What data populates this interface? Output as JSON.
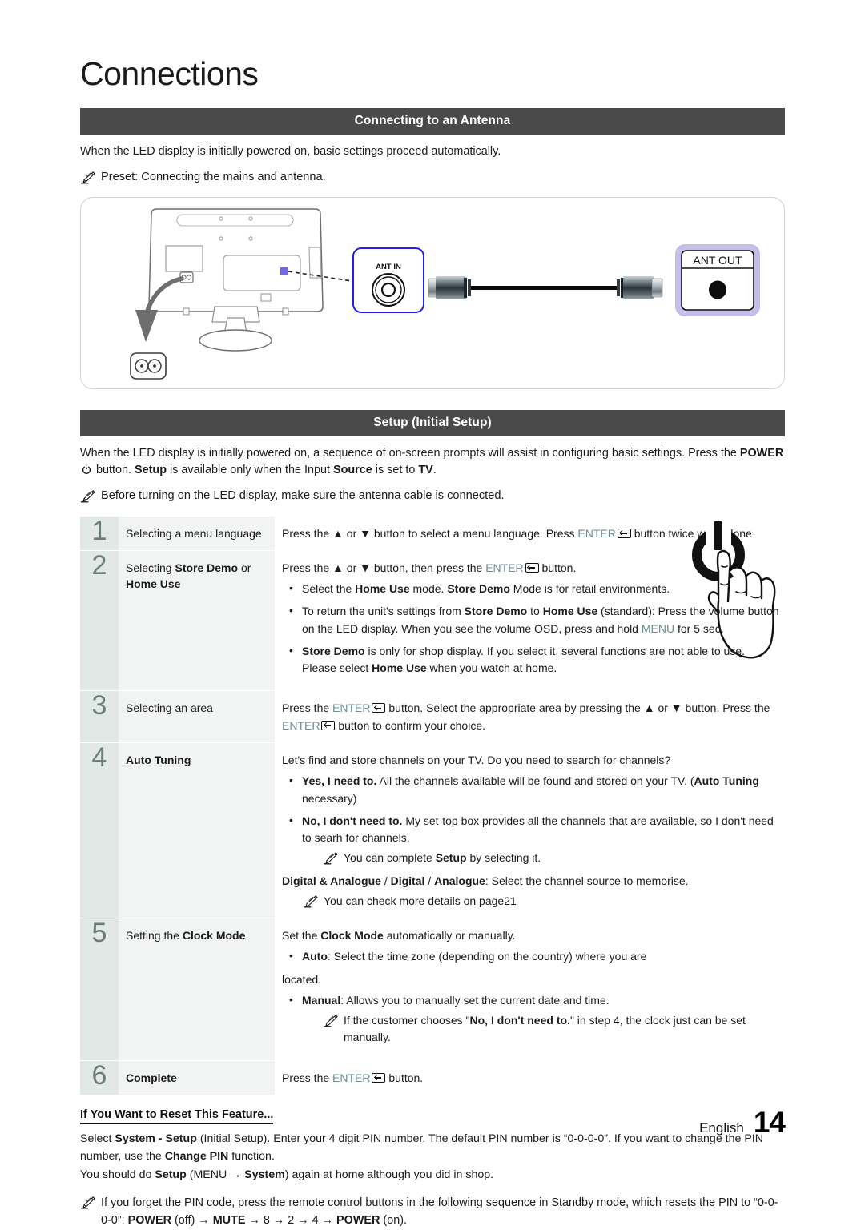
{
  "document": {
    "chapter_title": "Connections",
    "footer_language": "English",
    "page_number": "14"
  },
  "antenna_section": {
    "heading": "Connecting to an Antenna",
    "intro": "When the LED display is initially powered on, basic settings proceed automatically.",
    "note": "Preset: Connecting the mains and antenna.",
    "diagram": {
      "ant_in_label": "ANT IN",
      "ant_out_label": "ANT OUT",
      "power_input_label": "Power Input",
      "ant_in_border_color": "#2020f0",
      "ant_out_frame_color": "#c3bfe8",
      "port_highlight_color": "#6d6de0"
    }
  },
  "setup_section": {
    "heading": "Setup (Initial Setup)",
    "intro_part1": "When the LED display is initially powered on, a sequence of on-screen prompts will assist in configuring basic settings. Press the ",
    "intro_power": "POWER",
    "intro_part2": " button. ",
    "intro_setup_b": "Setup",
    "intro_part3": " is available only when the Input ",
    "intro_source_b": "Source",
    "intro_part4": " is set to ",
    "intro_tv_b": "TV",
    "intro_part5": ".",
    "note": "Before turning on the LED display, make sure the antenna cable is connected.",
    "hand_graphic_name": "power-button-press-illustration"
  },
  "steps": [
    {
      "number": "1",
      "title_plain_1": "Selecting a menu language",
      "desc_lead_a": "Press the ",
      "desc_up": "▲",
      "desc_lead_b": " or ",
      "desc_down": "▼",
      "desc_lead_c": " button to select a menu language. Press ",
      "enter": "ENTER",
      "desc_lead_d": " button twice when done"
    },
    {
      "number": "2",
      "title_a": "Selecting ",
      "title_b1": "Store Demo",
      "title_c": " or ",
      "title_b2": "Home Use",
      "desc_lead_a": "Press the ",
      "desc_up": "▲",
      "desc_lead_b": " or ",
      "desc_down": "▼",
      "desc_lead_c": " button, then press the ",
      "enter": "ENTER",
      "desc_lead_d": " button.",
      "bullets": [
        {
          "p1": "Select the ",
          "b1": "Home Use",
          "p2": " mode. ",
          "b2": "Store Demo",
          "p3": " Mode is for retail environments."
        },
        {
          "p1": "To return the unit's settings from ",
          "b1": "Store Demo",
          "p2": " to ",
          "b2": "Home Use",
          "p3": " (standard): Press the volume button on the LED display. When you see the volume OSD, press and hold ",
          "menu": "MENU",
          "p4": " for 5 sec."
        },
        {
          "b1": "Store Demo",
          "p1": " is only for shop display. If you select it, several functions are not able to use. Please select ",
          "b2": "Home Use",
          "p2": " when you watch at home."
        }
      ]
    },
    {
      "number": "3",
      "title_plain_1": "Selecting an area",
      "desc_a": "Press the ",
      "enter": "ENTER",
      "desc_b": " button. Select the appropriate area by pressing the ",
      "desc_up": "▲",
      "desc_c": " or ",
      "desc_down": "▼",
      "desc_d": " button. Press the ",
      "enter2": "ENTER",
      "desc_e": " button to confirm your choice."
    },
    {
      "number": "4",
      "title_bold": "Auto Tuning",
      "desc_lead": "Let's find and store channels on your TV. Do you need to search for channels?",
      "bullets": [
        {
          "b1": "Yes, I need to.",
          "p1": " All the channels available will be found and stored on your TV. (",
          "b2": "Auto Tuning",
          "p2": " necessary)"
        },
        {
          "b1": "No, I don't need to.",
          "p1": " My set-top box provides all the channels that are available, so I don't need to searh for channels.",
          "subnote_a": "You can complete ",
          "subnote_b": "Setup",
          "subnote_c": " by selecting it."
        }
      ],
      "tail_b1": "Digital & Analogue",
      "tail_p1": " / ",
      "tail_b2": "Digital",
      "tail_p2": " / ",
      "tail_b3": "Analogue",
      "tail_p3": ": Select the channel source to memorise.",
      "tail_note": "You can check more details on page21"
    },
    {
      "number": "5",
      "title_a": "Setting the ",
      "title_b": "Clock Mode",
      "desc_a": "Set the ",
      "desc_b": "Clock Mode",
      "desc_c": " automatically or manually.",
      "bullets": [
        {
          "b1": "Auto",
          "p1": ": Select the time zone (depending on the country) where you are"
        },
        {
          "b1": "Manual",
          "p1": ": Allows you to manually set the current date and time.",
          "subnote_a": "If the customer chooses \"",
          "subnote_b": "No, I don't need to.",
          "subnote_c": "\" in step 4, the clock just can be set manually."
        }
      ],
      "orphan_line": "located."
    },
    {
      "number": "6",
      "title_bold": "Complete",
      "desc_a": "Press the ",
      "enter": "ENTER",
      "desc_b": " button."
    }
  ],
  "reset_section": {
    "heading": "If You Want to Reset This Feature...",
    "line1_a": "Select ",
    "line1_b": "System - Setup",
    "line1_c": " (Initial Setup). Enter your 4 digit PIN number. The default PIN number is “0-0-0-0”. If you want to change the PIN number, use the ",
    "line1_d": "Change PIN",
    "line1_e": " function.",
    "line2_a": "You should do ",
    "line2_b": "Setup",
    "line2_c": " (MENU → ",
    "line2_d": "System",
    "line2_e": ") again at home although you did in shop.",
    "note_a": "If you forget the PIN code, press the remote control buttons in the following sequence in Standby mode, which resets the PIN to “0-0-0-0”: ",
    "note_power_off": "POWER",
    "note_b": " (off) → ",
    "note_mute": "MUTE",
    "note_c": " → 8 → 2 → 4 → ",
    "note_power_on": "POWER",
    "note_d": " (on)."
  }
}
